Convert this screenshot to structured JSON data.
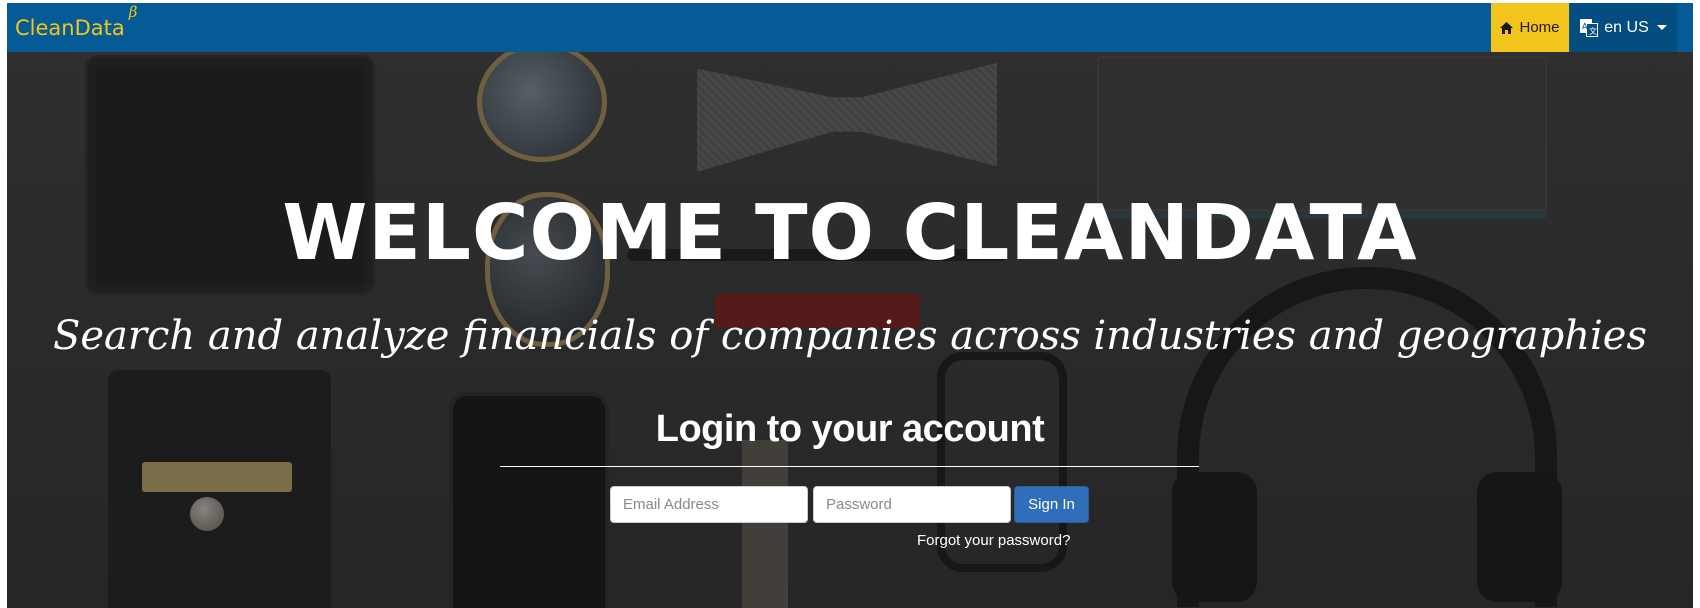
{
  "navbar": {
    "brand": "CleanData",
    "brand_mark": "β",
    "home_label": "Home",
    "home_icon": "home-icon",
    "language_label": "en US",
    "language_icon": "translate-icon",
    "colors": {
      "bar": "#045b96",
      "home_active": "#f3c51c",
      "brand": "#f3c51c"
    }
  },
  "hero": {
    "title": "WELCOME TO CLEANDATA",
    "subtitle": "Search and analyze financials of companies across industries and geographies",
    "login_heading": "Login to your account",
    "email_placeholder": "Email Address",
    "password_placeholder": "Password",
    "signin_label": "Sign In",
    "forgot_label": "Forgot your password?",
    "colors": {
      "signin": "#2f6fba"
    }
  }
}
